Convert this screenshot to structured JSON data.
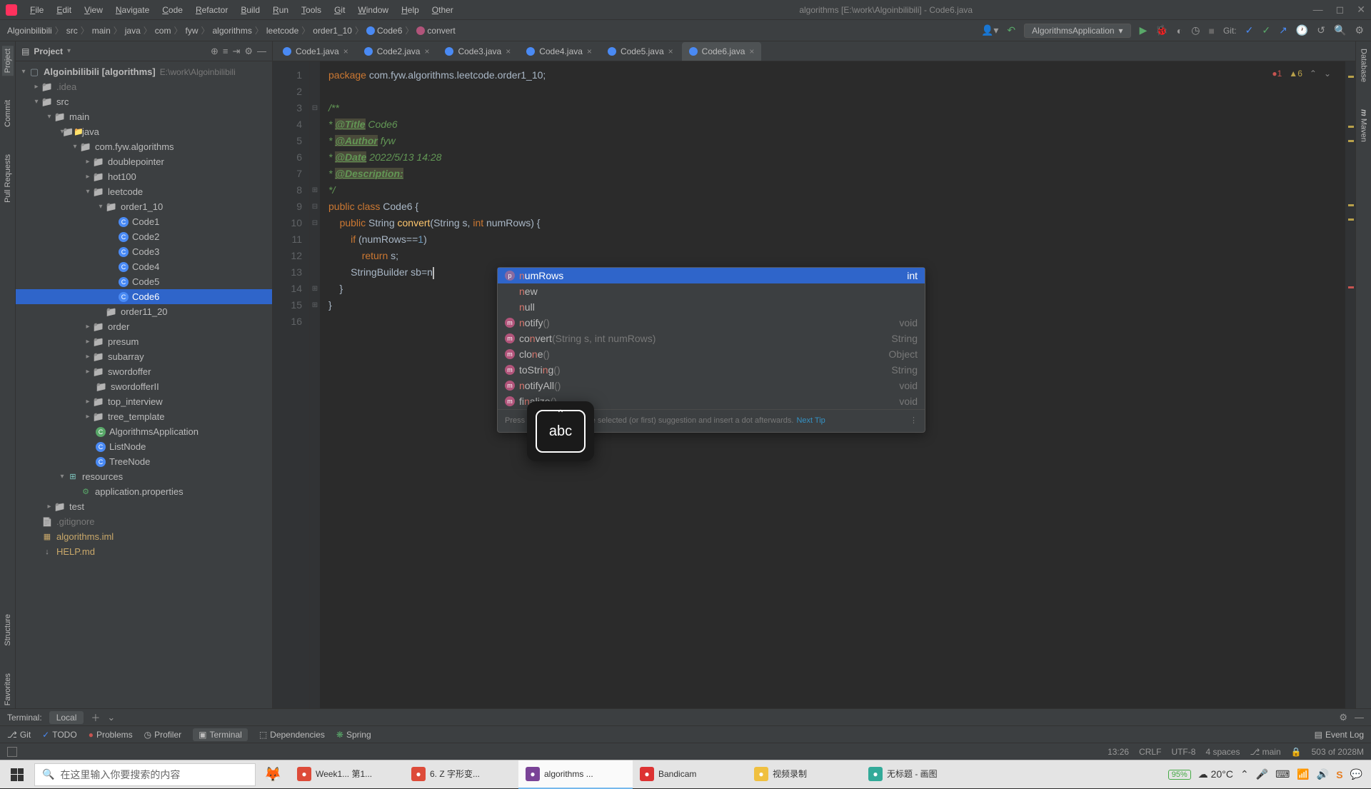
{
  "menu": [
    "File",
    "Edit",
    "View",
    "Navigate",
    "Code",
    "Refactor",
    "Build",
    "Run",
    "Tools",
    "Git",
    "Window",
    "Help",
    "Other"
  ],
  "windowTitle": "algorithms [E:\\work\\Algoinbilibili] - Code6.java",
  "breadcrumb": {
    "parts": [
      "Algoinbilibili",
      "src",
      "main",
      "java",
      "com",
      "fyw",
      "algorithms",
      "leetcode",
      "order1_10"
    ],
    "cls": "Code6",
    "method": "convert"
  },
  "runConfig": "AlgorithmsApplication",
  "gitLabel": "Git:",
  "leftRail": [
    "Project",
    "Commit",
    "Pull Requests",
    "Structure",
    "Favorites"
  ],
  "rightRail": [
    "Database",
    "Maven"
  ],
  "projectHeader": "Project",
  "tree": {
    "root": "Algoinbilibili [algorithms]",
    "rootHint": "E:\\work\\Algoinbilibili",
    "idea": ".idea",
    "src": "src",
    "main": "main",
    "java": "java",
    "pkg": "com.fyw.algorithms",
    "doublepointer": "doublepointer",
    "hot100": "hot100",
    "leetcode": "leetcode",
    "order1_10": "order1_10",
    "c1": "Code1",
    "c2": "Code2",
    "c3": "Code3",
    "c4": "Code4",
    "c5": "Code5",
    "c6": "Code6",
    "order11_20": "order11_20",
    "order": "order",
    "presum": "presum",
    "subarray": "subarray",
    "swordoffer": "swordoffer",
    "swordofferII": "swordofferII",
    "top_interview": "top_interview",
    "tree_template": "tree_template",
    "algoApp": "AlgorithmsApplication",
    "listNode": "ListNode",
    "treeNode": "TreeNode",
    "resources": "resources",
    "appProps": "application.properties",
    "test": "test",
    "gitignore": ".gitignore",
    "algoIml": "algorithms.iml",
    "help": "HELP.md"
  },
  "tabs": [
    "Code1.java",
    "Code2.java",
    "Code3.java",
    "Code4.java",
    "Code5.java",
    "Code6.java"
  ],
  "activeTab": 5,
  "lineNumbers": [
    1,
    2,
    3,
    4,
    5,
    6,
    7,
    8,
    9,
    10,
    11,
    12,
    13,
    14,
    15,
    16
  ],
  "code": {
    "pkg": "package ",
    "pkgPath": "com.fyw.algorithms.leetcode.order1_10",
    "docOpen": "/**",
    "titleTag": "@Title",
    "titleVal": " Code6",
    "authorTag": "@Author",
    "authorVal": " fyw",
    "dateTag": "@Date",
    "dateVal": " 2022/5/13 14:28",
    "descTag": "@Description:",
    "docClose": " */",
    "pub": "public ",
    "cls": "class ",
    "clsName": "Code6",
    "String": "String ",
    "convert": "convert",
    "sig": "(String s, ",
    "intkw": "int ",
    "numRows": "numRows) {",
    "ifkw": "if ",
    "cond": "(numRows==",
    "one": "1",
    "ret": "return ",
    "s": "s;",
    "sb": "StringBuilder sb=",
    "n": "n"
  },
  "inspect": {
    "errors": "1",
    "warnings": "6"
  },
  "completion": {
    "items": [
      {
        "icon": "p",
        "pre": "n",
        "name": "umRows",
        "sig": "",
        "type": "int",
        "sel": true
      },
      {
        "icon": "",
        "pre": "n",
        "name": "ew",
        "sig": "",
        "type": ""
      },
      {
        "icon": "",
        "pre": "n",
        "name": "ull",
        "sig": "",
        "type": ""
      },
      {
        "icon": "m",
        "pre": "n",
        "name": "otify",
        "sig": "()",
        "type": "void"
      },
      {
        "icon": "m",
        "pre": "",
        "name": "co",
        "hl": "n",
        "rest": "vert",
        "sig": "(String s, int numRows)",
        "type": "String"
      },
      {
        "icon": "m",
        "pre": "",
        "name": "clo",
        "hl": "n",
        "rest": "e",
        "sig": "()",
        "type": "Object"
      },
      {
        "icon": "m",
        "pre": "",
        "name": "toStri",
        "hl": "n",
        "rest": "g",
        "sig": "()",
        "type": "String"
      },
      {
        "icon": "m",
        "pre": "n",
        "name": "otifyAll",
        "sig": "()",
        "type": "void"
      },
      {
        "icon": "m",
        "pre": "",
        "name": "fi",
        "hl": "n",
        "rest": "alize",
        "sig": "()",
        "type": "void"
      }
    ],
    "footer": "Press Ctrl+. to choose the selected (or first) suggestion and insert a dot afterwards.",
    "nextTip": "Next Tip"
  },
  "ime": "abc",
  "terminal": {
    "title": "Terminal:",
    "tab": "Local"
  },
  "bottomTools": [
    "Git",
    "TODO",
    "Problems",
    "Profiler",
    "Terminal",
    "Dependencies",
    "Spring"
  ],
  "eventLog": "Event Log",
  "status": {
    "pos": "13:26",
    "eol": "CRLF",
    "enc": "UTF-8",
    "indent": "4 spaces",
    "branch": "main",
    "mem": "503 of 2028M"
  },
  "taskbar": {
    "search": "在这里输入你要搜索的内容",
    "apps": [
      {
        "label": "Week1... 第1...",
        "color": "#dd4b39",
        "active": false
      },
      {
        "label": "6. Z 字形变...",
        "color": "#dd4b39",
        "active": false
      },
      {
        "label": "algorithms ...",
        "color": "#7a4397",
        "active": true
      },
      {
        "label": "Bandicam",
        "color": "#d33",
        "active": false
      },
      {
        "label": "视频录制",
        "color": "#f0c040",
        "active": false
      },
      {
        "label": "无标题 - 画图",
        "color": "#3a9",
        "active": false
      }
    ],
    "battery": "95%",
    "temp": "20°C",
    "time": ""
  }
}
